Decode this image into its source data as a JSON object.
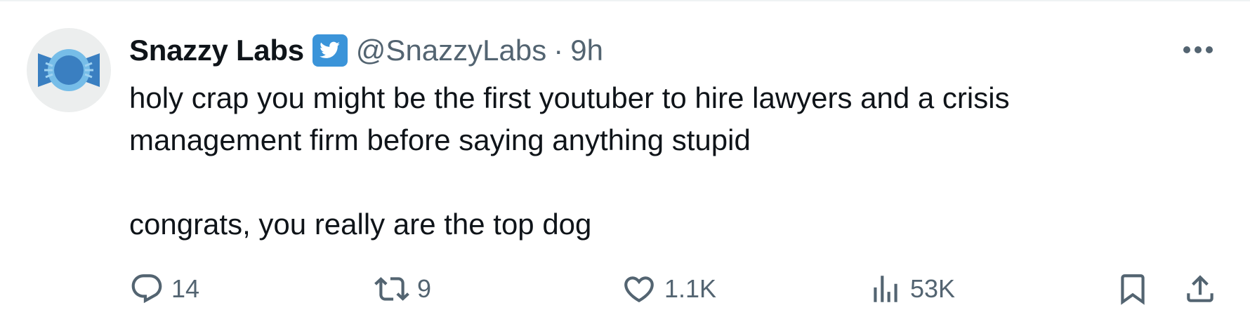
{
  "author": {
    "display_name": "Snazzy Labs",
    "handle": "@SnazzyLabs",
    "separator": "·",
    "time": "9h",
    "verified_badge_icon": "twitter-bird-icon",
    "avatar_icon": "snazzy-labs-logo"
  },
  "tweet": {
    "lines": [
      "holy crap you might be the first youtuber to hire lawyers and a crisis",
      "management firm before saying anything stupid",
      "congrats, you really are the top dog"
    ]
  },
  "actions": {
    "reply": {
      "icon": "reply-icon",
      "count": "14"
    },
    "retweet": {
      "icon": "retweet-icon",
      "count": "9"
    },
    "like": {
      "icon": "heart-icon",
      "count": "1.1K"
    },
    "views": {
      "icon": "views-chart-icon",
      "count": "53K"
    },
    "bookmark": {
      "icon": "bookmark-icon"
    },
    "share": {
      "icon": "share-icon"
    },
    "more": {
      "icon": "more-dots-icon"
    }
  },
  "colors": {
    "text_primary": "#0f1419",
    "text_secondary": "#536471",
    "twitter_blue": "#1d9bf0",
    "avatar_bg": "#eceeee"
  }
}
